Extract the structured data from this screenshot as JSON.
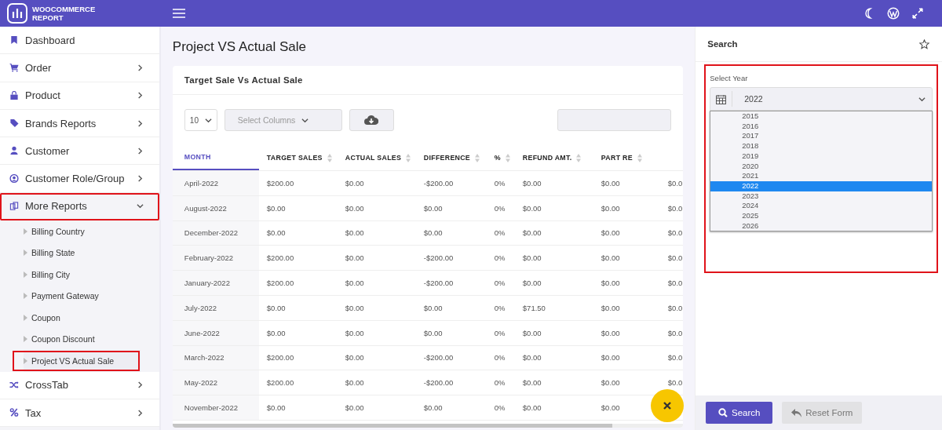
{
  "brand": {
    "line_1": "WOOCOMMERCE",
    "line_2": "REPORT"
  },
  "sidebar": {
    "items": [
      {
        "label": "Dashboard",
        "kind": "link",
        "expanded": false,
        "highlighted": false
      },
      {
        "label": "Order",
        "kind": "group",
        "expanded": false,
        "highlighted": false
      },
      {
        "label": "Product",
        "kind": "group",
        "expanded": false,
        "highlighted": false
      },
      {
        "label": "Brands Reports",
        "kind": "group",
        "expanded": false,
        "highlighted": false
      },
      {
        "label": "Customer",
        "kind": "group",
        "expanded": false,
        "highlighted": false
      },
      {
        "label": "Customer Role/Group",
        "kind": "group",
        "expanded": false,
        "highlighted": false
      },
      {
        "label": "More Reports",
        "kind": "group",
        "expanded": true,
        "highlighted": true,
        "children": [
          {
            "label": "Billing Country",
            "selected": false,
            "highlighted": false
          },
          {
            "label": "Billing State",
            "selected": false,
            "highlighted": false
          },
          {
            "label": "Billing City",
            "selected": false,
            "highlighted": false
          },
          {
            "label": "Payment Gateway",
            "selected": false,
            "highlighted": false
          },
          {
            "label": "Coupon",
            "selected": false,
            "highlighted": false
          },
          {
            "label": "Coupon Discount",
            "selected": false,
            "highlighted": false
          },
          {
            "label": "Project VS Actual Sale",
            "selected": true,
            "highlighted": true
          }
        ]
      },
      {
        "label": "CrossTab",
        "kind": "group",
        "expanded": false,
        "highlighted": false
      },
      {
        "label": "Tax",
        "kind": "group",
        "expanded": false,
        "highlighted": false
      }
    ]
  },
  "page_title": "Project VS Actual Sale",
  "card": {
    "title": "Target Sale Vs Actual Sale",
    "page_size": "10",
    "columns_placeholder": "Select Columns"
  },
  "table": {
    "columns": [
      {
        "label": "MONTH",
        "selected": true
      },
      {
        "label": "TARGET SALES",
        "selected": false
      },
      {
        "label": "ACTUAL SALES",
        "selected": false
      },
      {
        "label": "DIFFERENCE",
        "selected": false
      },
      {
        "label": "%",
        "selected": false
      },
      {
        "label": "REFUND AMT.",
        "selected": false
      },
      {
        "label": "PART RE",
        "selected": false
      }
    ],
    "rows": [
      [
        "April-2022",
        "$200.00",
        "$0.00",
        "-$200.00",
        "0%",
        "$0.00",
        "$0.00",
        "$0.0"
      ],
      [
        "August-2022",
        "$0.00",
        "$0.00",
        "$0.00",
        "0%",
        "$0.00",
        "$0.00",
        "$0.0"
      ],
      [
        "December-2022",
        "$0.00",
        "$0.00",
        "$0.00",
        "0%",
        "$0.00",
        "$0.00",
        "$0.0"
      ],
      [
        "February-2022",
        "$200.00",
        "$0.00",
        "-$200.00",
        "0%",
        "$0.00",
        "$0.00",
        "$0.0"
      ],
      [
        "January-2022",
        "$200.00",
        "$0.00",
        "-$200.00",
        "0%",
        "$0.00",
        "$0.00",
        "$0.0"
      ],
      [
        "July-2022",
        "$0.00",
        "$0.00",
        "$0.00",
        "0%",
        "$71.50",
        "$0.00",
        "$0.0"
      ],
      [
        "June-2022",
        "$0.00",
        "$0.00",
        "$0.00",
        "0%",
        "$0.00",
        "$0.00",
        "$0.0"
      ],
      [
        "March-2022",
        "$200.00",
        "$0.00",
        "-$200.00",
        "0%",
        "$0.00",
        "$0.00",
        "$0.0"
      ],
      [
        "May-2022",
        "$200.00",
        "$0.00",
        "-$200.00",
        "0%",
        "$0.00",
        "$0.00",
        "$0.0"
      ],
      [
        "November-2022",
        "$0.00",
        "$0.00",
        "$0.00",
        "0%",
        "$0.00",
        "$0.00"
      ]
    ]
  },
  "search_panel": {
    "title": "Search",
    "highlighted": true,
    "year_label": "Select Year",
    "year_value": "2022",
    "year_options": [
      {
        "label": "2015",
        "selected": false
      },
      {
        "label": "2016",
        "selected": false
      },
      {
        "label": "2017",
        "selected": false
      },
      {
        "label": "2018",
        "selected": false
      },
      {
        "label": "2019",
        "selected": false
      },
      {
        "label": "2020",
        "selected": false
      },
      {
        "label": "2021",
        "selected": false
      },
      {
        "label": "2022",
        "selected": true
      },
      {
        "label": "2023",
        "selected": false
      },
      {
        "label": "2024",
        "selected": false
      },
      {
        "label": "2025",
        "selected": false
      },
      {
        "label": "2026",
        "selected": false
      }
    ],
    "buttons": [
      "Search",
      "Reset Form"
    ]
  }
}
